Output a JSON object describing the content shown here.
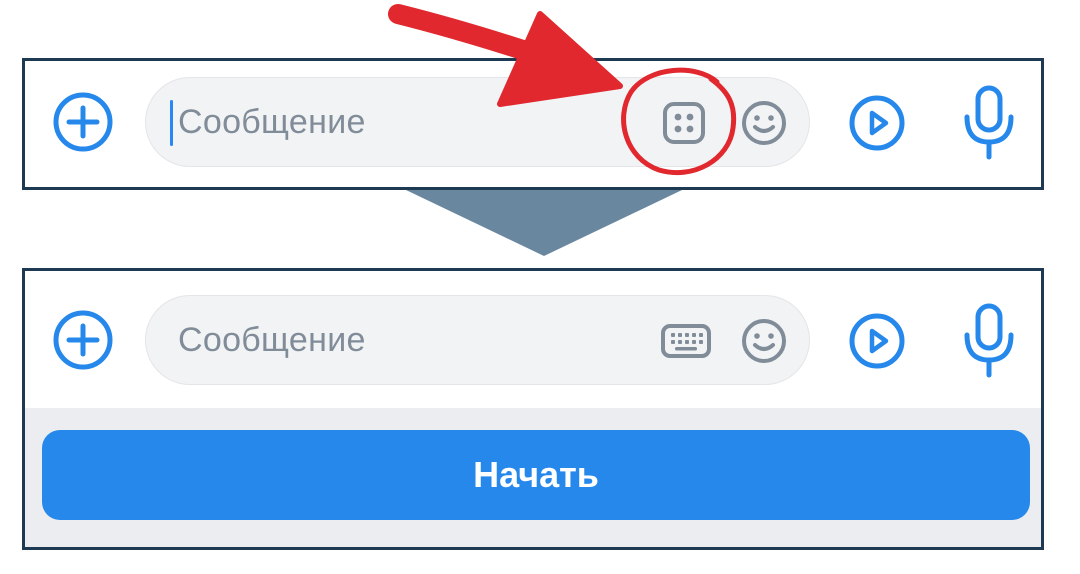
{
  "top_panel": {
    "message_placeholder": "Сообщение",
    "keyboard_toggle_icon": "bot-keyboard-icon"
  },
  "bottom_panel": {
    "message_placeholder": "Сообщение",
    "keyboard_toggle_icon": "keyboard-icon",
    "start_button_label": "Начать"
  },
  "icons": {
    "attach": "plus-circle-icon",
    "emoji": "smile-icon",
    "video": "play-circle-icon",
    "voice": "microphone-icon"
  },
  "colors": {
    "accent": "#2688eb",
    "icon_gray": "#818c99",
    "panel_border": "#1e3a52",
    "annotation_red": "#e0282e",
    "transition_arrow": "#6a87a0",
    "keyboard_bg": "#ebedf0"
  }
}
